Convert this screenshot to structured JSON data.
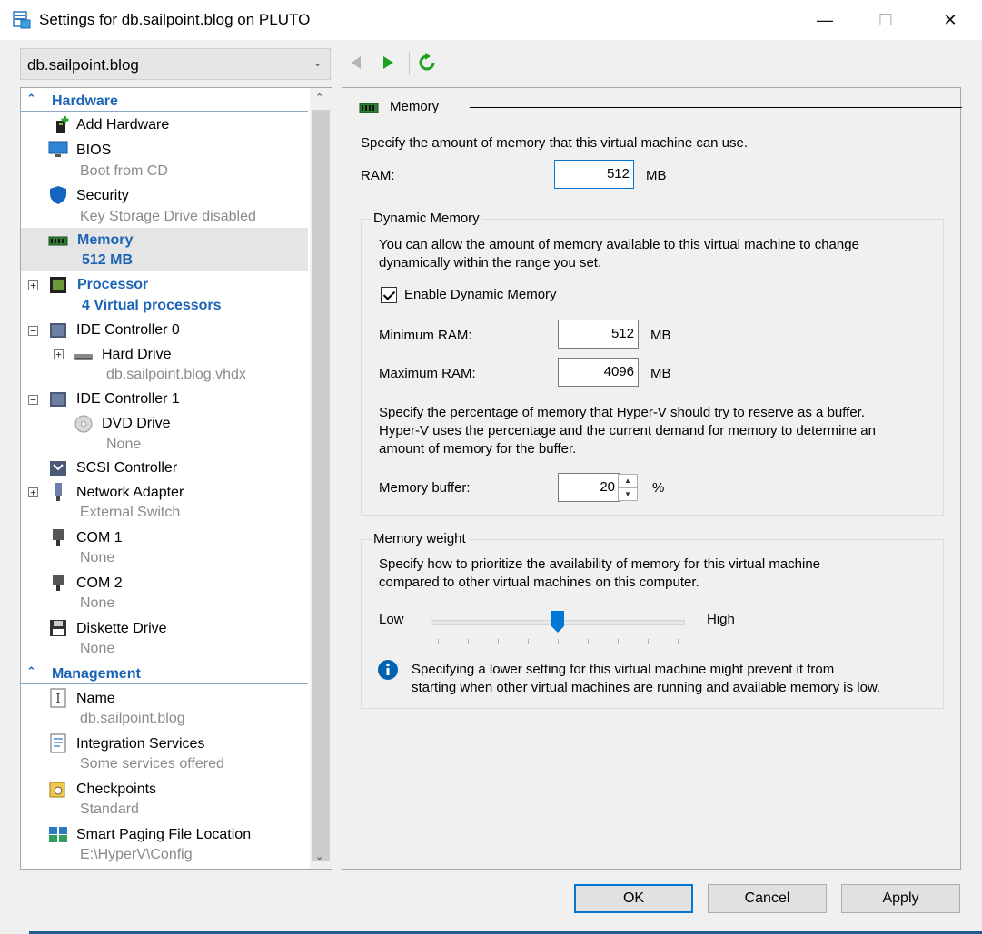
{
  "window": {
    "title": "Settings for db.sailpoint.blog on PLUTO",
    "controls": {
      "minimize": "—",
      "maximize": "☐",
      "close": "✕"
    }
  },
  "vm_selector": {
    "value": "db.sailpoint.blog",
    "chevron": "⌄"
  },
  "toolbar": {
    "back_icon": "back-arrow-icon",
    "forward_icon": "forward-arrow-icon",
    "refresh_icon": "refresh-icon"
  },
  "sidebar": {
    "hardware_label": "Hardware",
    "management_label": "Management",
    "items": {
      "add_hardware": {
        "label": "Add Hardware"
      },
      "bios": {
        "label": "BIOS",
        "sub": "Boot from CD"
      },
      "security": {
        "label": "Security",
        "sub": "Key Storage Drive disabled"
      },
      "memory": {
        "label": "Memory",
        "sub": "512 MB"
      },
      "processor": {
        "label": "Processor",
        "sub": "4 Virtual processors"
      },
      "ide0": {
        "label": "IDE Controller 0"
      },
      "hard_drive": {
        "label": "Hard Drive",
        "sub": "db.sailpoint.blog.vhdx"
      },
      "ide1": {
        "label": "IDE Controller 1"
      },
      "dvd": {
        "label": "DVD Drive",
        "sub": "None"
      },
      "scsi": {
        "label": "SCSI Controller"
      },
      "network": {
        "label": "Network Adapter",
        "sub": "External Switch"
      },
      "com1": {
        "label": "COM 1",
        "sub": "None"
      },
      "com2": {
        "label": "COM 2",
        "sub": "None"
      },
      "diskette": {
        "label": "Diskette Drive",
        "sub": "None"
      },
      "name": {
        "label": "Name",
        "sub": "db.sailpoint.blog"
      },
      "integration": {
        "label": "Integration Services",
        "sub": "Some services offered"
      },
      "checkpoints": {
        "label": "Checkpoints",
        "sub": "Standard"
      },
      "smart_paging": {
        "label": "Smart Paging File Location",
        "sub": "E:\\HyperV\\Config"
      }
    }
  },
  "memory_panel": {
    "heading": "Memory",
    "intro": "Specify the amount of memory that this virtual machine can use.",
    "ram_label": "RAM:",
    "ram_value": "512",
    "ram_unit": "MB",
    "dynamic": {
      "title": "Dynamic Memory",
      "desc_line1": "You can allow the amount of memory available to this virtual machine to change",
      "desc_line2": "dynamically within the range you set.",
      "enable_label": "Enable Dynamic Memory",
      "enable_checked": true,
      "min_label": "Minimum RAM:",
      "min_value": "512",
      "min_unit": "MB",
      "max_label": "Maximum RAM:",
      "max_value": "4096",
      "max_unit": "MB",
      "buffer_desc_line1": "Specify the percentage of memory that Hyper-V should try to reserve as a buffer.",
      "buffer_desc_line2": "Hyper-V uses the percentage and the current demand for memory to determine an",
      "buffer_desc_line3": "amount of memory for the buffer.",
      "buffer_label": "Memory buffer:",
      "buffer_value": "20",
      "buffer_unit": "%"
    },
    "weight": {
      "title": "Memory weight",
      "desc_line1": "Specify how to prioritize the availability of memory for this virtual machine",
      "desc_line2": "compared to other virtual machines on this computer.",
      "low_label": "Low",
      "high_label": "High",
      "slider_level": 0.5,
      "info_line1": "Specifying a lower setting for this virtual machine might prevent it from",
      "info_line2": "starting when other virtual machines are running and available memory is low."
    }
  },
  "buttons": {
    "ok": "OK",
    "cancel": "Cancel",
    "apply": "Apply"
  },
  "colors": {
    "accent": "#0078d7",
    "category_blue": "#1c64b5",
    "play_green": "#1ea21e"
  }
}
